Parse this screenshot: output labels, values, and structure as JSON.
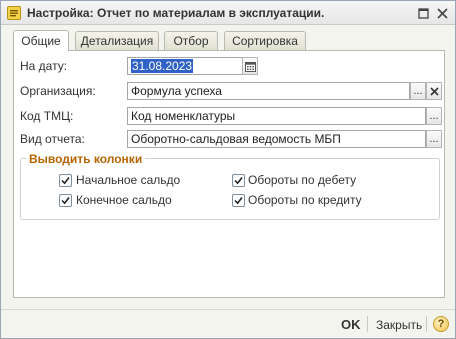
{
  "window": {
    "title": "Настройка: Отчет по материалам в эксплуатации."
  },
  "tabs": [
    {
      "label": "Общие",
      "active": true
    },
    {
      "label": "Детализация",
      "active": false
    },
    {
      "label": "Отбор",
      "active": false
    },
    {
      "label": "Сортировка",
      "active": false
    }
  ],
  "fields": {
    "date": {
      "label": "На дату:",
      "value": "31.08.2023"
    },
    "organization": {
      "label": "Организация:",
      "value": "Формула успеха",
      "select_button": "...",
      "clear_button": "×"
    },
    "tmc_code": {
      "label": "Код ТМЦ:",
      "value": "Код номенклатуры",
      "select_button": "..."
    },
    "report_type": {
      "label": "Вид отчета:",
      "value": "Оборотно-сальдовая ведомость МБП",
      "select_button": "..."
    }
  },
  "columns_group": {
    "title": "Выводить колонки",
    "checkboxes": [
      {
        "label": "Начальное сальдо",
        "checked": true
      },
      {
        "label": "Конечное сальдо",
        "checked": true
      },
      {
        "label": "Обороты по дебету",
        "checked": true
      },
      {
        "label": "Обороты по кредиту",
        "checked": true
      }
    ]
  },
  "footer": {
    "ok_label": "OK",
    "close_label": "Закрыть",
    "help_label": "?"
  },
  "colors": {
    "group_title": "#b46400",
    "selection": "#2f62c6"
  }
}
